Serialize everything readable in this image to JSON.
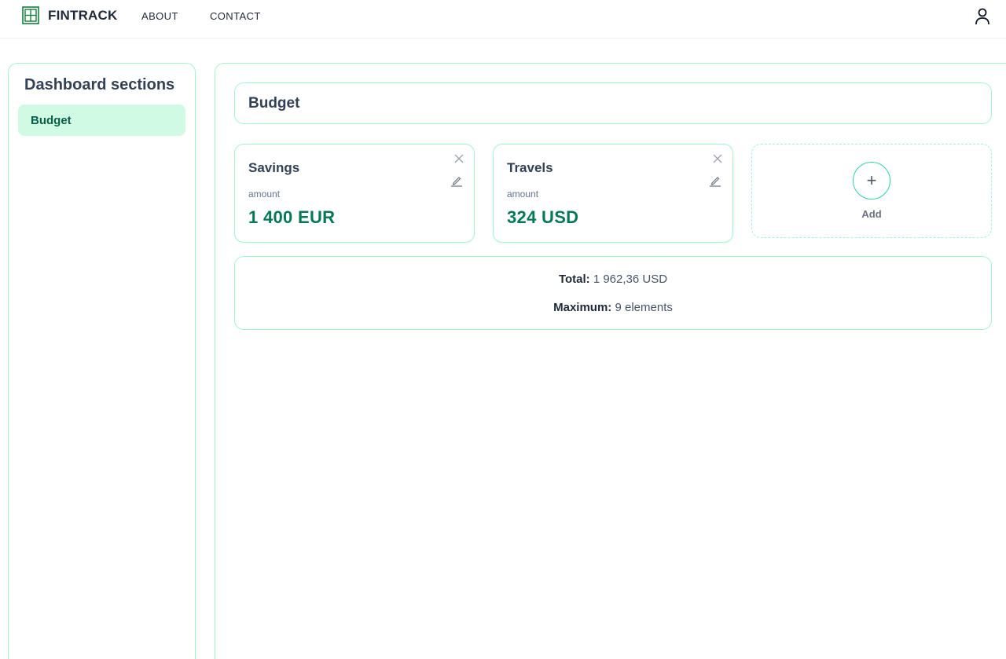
{
  "nav": {
    "brand": "FINTRACK",
    "links": [
      "ABOUT",
      "CONTACT"
    ]
  },
  "sidebar": {
    "title": "Dashboard sections",
    "items": [
      {
        "label": "Budget",
        "active": true
      }
    ]
  },
  "main": {
    "section_title": "Budget",
    "cards": [
      {
        "name": "Savings",
        "amount_label": "amount",
        "amount": "1 400 EUR"
      },
      {
        "name": "Travels",
        "amount_label": "amount",
        "amount": "324 USD"
      }
    ],
    "add_label": "Add",
    "add_symbol": "+",
    "summary": {
      "total_label": "Total:",
      "total_value": "1 962,36 USD",
      "max_label": "Maximum:",
      "max_value": "9 elements"
    }
  },
  "colors": {
    "accent_border": "#a7f3d0",
    "accent_fill": "#d1fae5",
    "amount_green": "#047857"
  },
  "icons": [
    "fintrack-logo-icon",
    "user-icon",
    "close-icon",
    "edit-pencil-icon",
    "plus-icon"
  ]
}
